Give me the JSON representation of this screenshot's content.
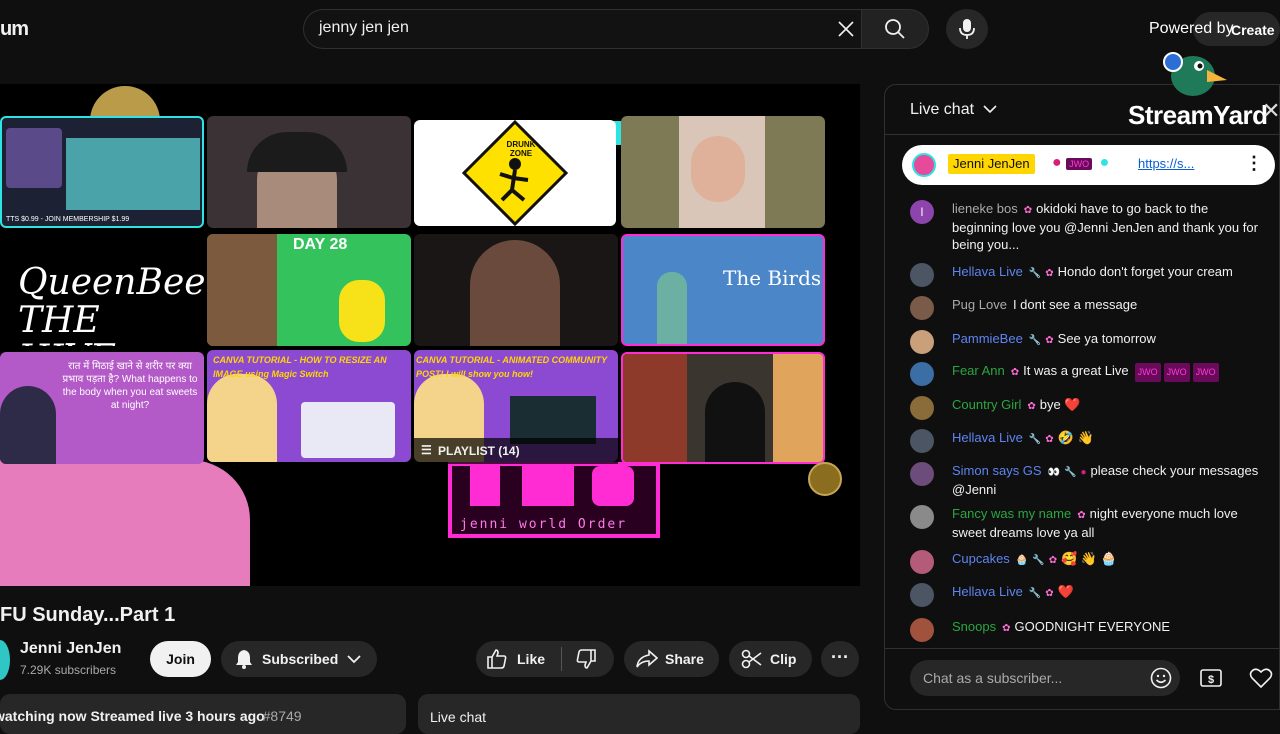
{
  "header": {
    "logo_text": "um",
    "search_value": "jenny jen jen",
    "powered_by": "Powered by",
    "create_label": "Create"
  },
  "video": {
    "title_text": "FU Sunday...Part 1",
    "playlist_label": "PLAYLIST (14)",
    "tiles": [
      {
        "caption": "TTS $0.99 - JOIN MEMBERSHIP $1.99"
      },
      {
        "caption": ""
      },
      {
        "caption": "DRUNK ZONE"
      },
      {
        "caption": ""
      },
      {
        "caption": "QueenBee THE HIVE"
      },
      {
        "caption": "DAY 28"
      },
      {
        "caption": ""
      },
      {
        "caption": "The Birds"
      },
      {
        "caption": "रात में मिठाई खाने से शरीर पर क्या प्रभाव पड़ता है? What happens to the body when you eat sweets at night?"
      },
      {
        "caption": "CANVA TUTORIAL - HOW TO RESIZE AN IMAGE using Magic Switch"
      },
      {
        "caption": "CANVA TUTORIAL - ANIMATED COMMUNITY POST! I will show you how!"
      },
      {
        "caption": ""
      }
    ],
    "overlay_text": "jenni world Order"
  },
  "channel": {
    "name": "Jenni JenJen",
    "subscribers": "7.29K subscribers",
    "join_label": "Join",
    "subscribed_label": "Subscribed"
  },
  "actions": {
    "like_label": "Like",
    "share_label": "Share",
    "clip_label": "Clip"
  },
  "description": {
    "meta": "watching now  Streamed live 3 hours ago  ",
    "hashtag": "#8749"
  },
  "below_live_chat_label": "Live chat",
  "chat": {
    "header_label": "Live chat",
    "streamyard": "StreamYard",
    "pinned": {
      "author": "Jenni JenJen",
      "link": "https://s..."
    },
    "messages": [
      {
        "author": "lieneke bos",
        "author_color": "#aaaaaa",
        "text": "okidoki have to go back to the beginning love you @Jenni JenJen and thank you for being you...",
        "avatar_color": "#8e44ad",
        "avatar_letter": "l"
      },
      {
        "author": "Hellava Live",
        "author_color": "#5e84f1",
        "text": "Hondo don't forget your cream",
        "avatar_color": "#4b5563"
      },
      {
        "author": "Pug Love",
        "author_color": "#aaaaaa",
        "text": "I dont see a message",
        "avatar_color": "#7a5b4a"
      },
      {
        "author": "PammieBee",
        "author_color": "#5e84f1",
        "text": "See ya tomorrow",
        "avatar_color": "#c9a07a"
      },
      {
        "author": "Fear Ann",
        "author_color": "#2ba640",
        "text": "It was a great Live",
        "avatar_color": "#3a6ea5"
      },
      {
        "author": "Country Girl",
        "author_color": "#2ba640",
        "text": "bye ❤️",
        "avatar_color": "#8a6b3a"
      },
      {
        "author": "Hellava Live",
        "author_color": "#5e84f1",
        "text": "🤣 👋",
        "avatar_color": "#4b5563"
      },
      {
        "author": "Simon says GS",
        "author_color": "#5e84f1",
        "text": "please check your messages @Jenni",
        "avatar_color": "#6b4c7a"
      },
      {
        "author": "Fancy was my name",
        "author_color": "#2ba640",
        "text": "night everyone much love sweet dreams love ya all",
        "avatar_color": "#8a8a8a"
      },
      {
        "author": "Cupcakes",
        "author_color": "#5e84f1",
        "text": "🥰 👋 🧁",
        "avatar_color": "#b55b7a"
      },
      {
        "author": "Hellava Live",
        "author_color": "#5e84f1",
        "text": "❤️",
        "avatar_color": "#4b5563"
      },
      {
        "author": "Snoops",
        "author_color": "#2ba640",
        "text": "GOODNIGHT EVERYONE",
        "avatar_color": "#a0523d"
      }
    ],
    "input_placeholder": "Chat as a subscriber..."
  },
  "colors": {
    "background": "#0f0f0f",
    "accent_pink": "#ff2bd3",
    "accent_cyan": "#2ee3e3",
    "pinned_name_bg": "#ffd600"
  }
}
